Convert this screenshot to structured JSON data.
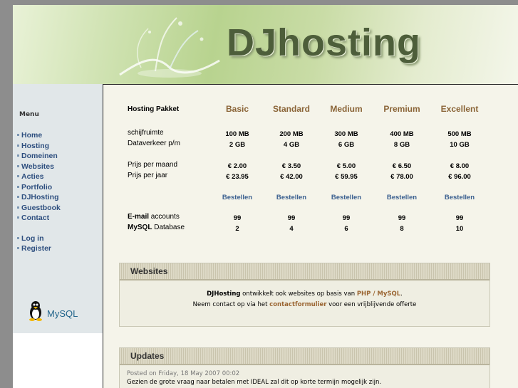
{
  "brand": {
    "logo_text": "DJhosting"
  },
  "sidebar": {
    "menu_title": "Menu",
    "items": [
      {
        "label": "Home"
      },
      {
        "label": "Hosting"
      },
      {
        "label": "Domeinen"
      },
      {
        "label": "Websites"
      },
      {
        "label": "Acties"
      },
      {
        "label": "Portfolio"
      },
      {
        "label": "DJHosting"
      },
      {
        "label": "Guestbook"
      },
      {
        "label": "Contact"
      }
    ],
    "account_items": [
      {
        "label": "Log in"
      },
      {
        "label": "Register"
      }
    ],
    "badge_mysql": "MySQL"
  },
  "pricing": {
    "header_label": "Hosting Pakket",
    "plans": [
      "Basic",
      "Standard",
      "Medium",
      "Premium",
      "Excellent"
    ],
    "rows": {
      "schijfruimte": {
        "label": "schijfruimte",
        "values": [
          "100 MB",
          "200 MB",
          "300 MB",
          "400 MB",
          "500 MB"
        ]
      },
      "dataverkeer": {
        "label": "Dataverkeer p/m",
        "values": [
          "2 GB",
          "4 GB",
          "6 GB",
          "8 GB",
          "10 GB"
        ]
      },
      "maand": {
        "label": "Prijs per maand",
        "values": [
          "€ 2.00",
          "€ 3.50",
          "€ 5.00",
          "€ 6.50",
          "€ 8.00"
        ]
      },
      "jaar": {
        "label": "Prijs per jaar",
        "values": [
          "€ 23.95",
          "€ 42.00",
          "€ 59.95",
          "€ 78.00",
          "€ 96.00"
        ]
      }
    },
    "order_label": "Bestellen",
    "email": {
      "label_bold": "E-mail",
      "label_rest": " accounts",
      "values": [
        "99",
        "99",
        "99",
        "99",
        "99"
      ]
    },
    "mysql": {
      "label_bold": "MySQL",
      "label_rest": " Database",
      "values": [
        "2",
        "4",
        "6",
        "8",
        "10"
      ]
    }
  },
  "websites_panel": {
    "title": "Websites",
    "line1_brand": "DJHosting",
    "line1_mid": " ontwikkelt ook websites op basis van ",
    "line1_link": "PHP / MySQL",
    "line1_end": ".",
    "line2_start": "Neem contact op via het ",
    "line2_link": "contactformulier",
    "line2_end": " voor een vrijblijvende offerte"
  },
  "updates_panel": {
    "title": "Updates",
    "posted": "Posted on Friday, 18 May 2007 00:02",
    "text": "Gezien de grote vraag naar betalen met IDEAL zal dit op korte termijn mogelijk zijn."
  }
}
